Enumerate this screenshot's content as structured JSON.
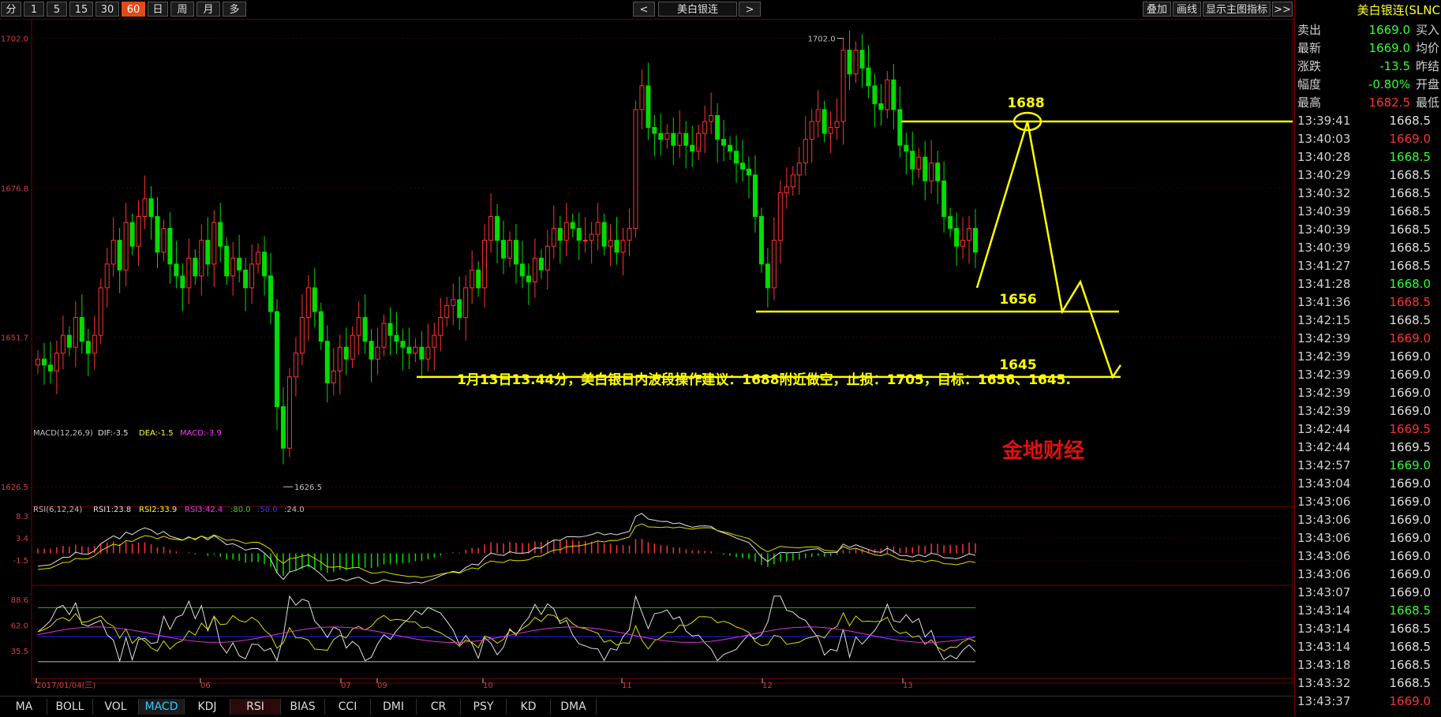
{
  "toolbar": {
    "periods": [
      "分",
      "1",
      "5",
      "15",
      "30",
      "60",
      "日",
      "周",
      "月",
      "多"
    ],
    "active_period": "60",
    "prev_label": "<",
    "instrument": "美白银连",
    "next_label": ">",
    "overlay_button": "叠加",
    "draw_button": "画线",
    "indicator_button": "显示主图指标",
    "more_button": ">>"
  },
  "main_chart": {
    "y_ticks": [
      "1702.0",
      "1676.8",
      "1651.7",
      "1626.5"
    ],
    "high_marker": "1702.0",
    "low_marker": "1626.5",
    "levels": [
      {
        "label": "1688",
        "value": 1688
      },
      {
        "label": "1656",
        "value": 1656
      },
      {
        "label": "1645",
        "value": 1645
      }
    ],
    "annotation": "1月13日13.44分，美白银日内波段操作建议：1688附近做空，止损：1705，目标：1656、1645.",
    "watermark": "金地财经",
    "level_color": "#ffff00",
    "up_color": "#ff3333",
    "down_color": "#00dd00"
  },
  "macd_panel": {
    "label_prefix": "MACD(12,26,9)",
    "dif": "DIF:-3.5",
    "dea": "DEA:-1.5",
    "macd": "MACD:-3.9",
    "y_ticks": [
      "8.3",
      "3.4",
      "-1.5"
    ]
  },
  "rsi_panel": {
    "label_prefix": "RSI(6,12,24)",
    "rsi1": "RSI1:23.8",
    "rsi2": "RSI2:33.9",
    "rsi3": "RSI3:42.4",
    "l80": ":80.0",
    "l50": ":50.0",
    "l24": ":24.0",
    "y_ticks": [
      "88.6",
      "62.0",
      "35.5"
    ]
  },
  "date_axis": [
    "2017/01/04(三)",
    "06",
    "07",
    "09",
    "10",
    "11",
    "12",
    "13"
  ],
  "quote_panel": {
    "title": "美白银连(SLNC",
    "rows": [
      {
        "label": "卖出",
        "value": "1669.0",
        "tail": "买入",
        "color": "#33ff33"
      },
      {
        "label": "最新",
        "value": "1669.0",
        "tail": "均价",
        "color": "#33ff33"
      },
      {
        "label": "涨跌",
        "value": "-13.5",
        "tail": "昨结",
        "color": "#33ff33"
      },
      {
        "label": "幅度",
        "value": "-0.80%",
        "tail": "开盘",
        "color": "#33ff33"
      },
      {
        "label": "最高",
        "value": "1682.5",
        "tail": "最低",
        "color": "#ff3333"
      }
    ],
    "ticks": [
      {
        "time": "13:39:41",
        "price": "1668.5",
        "color": "#e0e0e0"
      },
      {
        "time": "13:40:03",
        "price": "1669.0",
        "color": "#ff3333"
      },
      {
        "time": "13:40:28",
        "price": "1668.5",
        "color": "#33ff33"
      },
      {
        "time": "13:40:29",
        "price": "1668.5",
        "color": "#e0e0e0"
      },
      {
        "time": "13:40:32",
        "price": "1668.5",
        "color": "#e0e0e0"
      },
      {
        "time": "13:40:39",
        "price": "1668.5",
        "color": "#e0e0e0"
      },
      {
        "time": "13:40:39",
        "price": "1668.5",
        "color": "#e0e0e0"
      },
      {
        "time": "13:40:39",
        "price": "1668.5",
        "color": "#e0e0e0"
      },
      {
        "time": "13:41:27",
        "price": "1668.5",
        "color": "#e0e0e0"
      },
      {
        "time": "13:41:28",
        "price": "1668.0",
        "color": "#33ff33"
      },
      {
        "time": "13:41:36",
        "price": "1668.5",
        "color": "#ff3333"
      },
      {
        "time": "13:42:15",
        "price": "1668.5",
        "color": "#e0e0e0"
      },
      {
        "time": "13:42:39",
        "price": "1669.0",
        "color": "#ff3333"
      },
      {
        "time": "13:42:39",
        "price": "1669.0",
        "color": "#e0e0e0"
      },
      {
        "time": "13:42:39",
        "price": "1669.0",
        "color": "#e0e0e0"
      },
      {
        "time": "13:42:39",
        "price": "1669.0",
        "color": "#e0e0e0"
      },
      {
        "time": "13:42:39",
        "price": "1669.0",
        "color": "#e0e0e0"
      },
      {
        "time": "13:42:44",
        "price": "1669.5",
        "color": "#ff3333"
      },
      {
        "time": "13:42:44",
        "price": "1669.5",
        "color": "#e0e0e0"
      },
      {
        "time": "13:42:57",
        "price": "1669.0",
        "color": "#33ff33"
      },
      {
        "time": "13:43:04",
        "price": "1669.0",
        "color": "#e0e0e0"
      },
      {
        "time": "13:43:06",
        "price": "1669.0",
        "color": "#e0e0e0"
      },
      {
        "time": "13:43:06",
        "price": "1669.0",
        "color": "#e0e0e0"
      },
      {
        "time": "13:43:06",
        "price": "1669.0",
        "color": "#e0e0e0"
      },
      {
        "time": "13:43:06",
        "price": "1669.0",
        "color": "#e0e0e0"
      },
      {
        "time": "13:43:06",
        "price": "1669.0",
        "color": "#e0e0e0"
      },
      {
        "time": "13:43:07",
        "price": "1669.0",
        "color": "#e0e0e0"
      },
      {
        "time": "13:43:14",
        "price": "1668.5",
        "color": "#33ff33"
      },
      {
        "time": "13:43:14",
        "price": "1668.5",
        "color": "#e0e0e0"
      },
      {
        "time": "13:43:14",
        "price": "1668.5",
        "color": "#e0e0e0"
      },
      {
        "time": "13:43:18",
        "price": "1668.5",
        "color": "#e0e0e0"
      },
      {
        "time": "13:43:32",
        "price": "1668.5",
        "color": "#e0e0e0"
      },
      {
        "time": "13:43:37",
        "price": "1669.0",
        "color": "#ff3333"
      }
    ]
  },
  "indicator_tabs": [
    "MA",
    "BOLL",
    "VOL",
    "MACD",
    "KDJ",
    "RSI",
    "BIAS",
    "CCI",
    "DMI",
    "CR",
    "PSY",
    "KD",
    "DMA"
  ],
  "active_tab": "MACD"
}
